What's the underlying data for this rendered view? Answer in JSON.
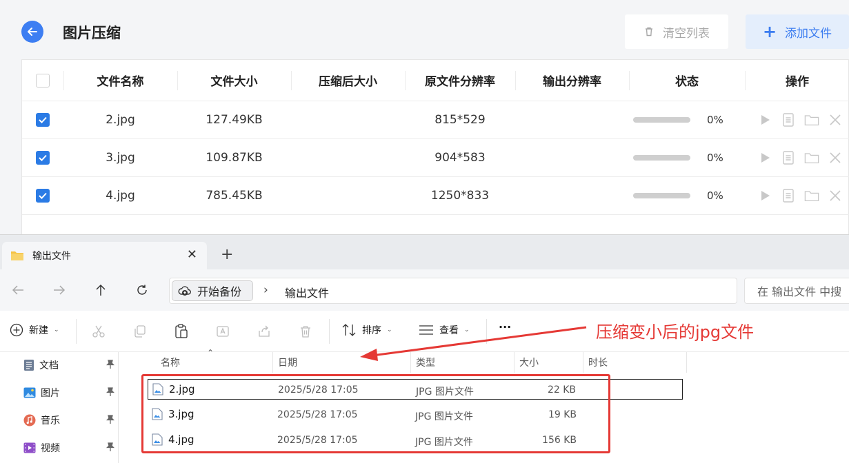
{
  "app": {
    "title": "图片压缩",
    "clear_label": "清空列表",
    "add_label": "添加文件",
    "accent_color": "#3b7cf0",
    "columns": [
      "文件名称",
      "文件大小",
      "压缩后大小",
      "原文件分辨率",
      "输出分辨率",
      "状态",
      "操作"
    ],
    "rows": [
      {
        "checked": true,
        "name": "2.jpg",
        "size": "127.49KB",
        "compressed_size": "",
        "orig_res": "815*529",
        "out_res": "",
        "progress": 0,
        "progress_text": "0%"
      },
      {
        "checked": true,
        "name": "3.jpg",
        "size": "109.87KB",
        "compressed_size": "",
        "orig_res": "904*583",
        "out_res": "",
        "progress": 0,
        "progress_text": "0%"
      },
      {
        "checked": true,
        "name": "4.jpg",
        "size": "785.45KB",
        "compressed_size": "",
        "orig_res": "1250*833",
        "out_res": "",
        "progress": 0,
        "progress_text": "0%"
      }
    ],
    "row_actions": [
      "play-icon",
      "document-icon",
      "folder-icon",
      "close-icon"
    ]
  },
  "explorer": {
    "tab_title": "输出文件",
    "breadcrumb_chip": "开始备份",
    "breadcrumb_folder": "输出文件",
    "search_placeholder": "在 输出文件 中搜",
    "toolbar": {
      "new_label": "新建",
      "sort_label": "排序",
      "view_label": "查看",
      "more_label": "···"
    },
    "sidebar": [
      {
        "label": "文档",
        "icon": "document-icon"
      },
      {
        "label": "图片",
        "icon": "picture-icon"
      },
      {
        "label": "音乐",
        "icon": "music-icon"
      },
      {
        "label": "视频",
        "icon": "video-icon"
      }
    ],
    "columns": [
      "名称",
      "日期",
      "类型",
      "大小",
      "时长"
    ],
    "files": [
      {
        "name": "2.jpg",
        "date": "2025/5/28 17:05",
        "type": "JPG 图片文件",
        "size": "22 KB",
        "selected": true
      },
      {
        "name": "3.jpg",
        "date": "2025/5/28 17:05",
        "type": "JPG 图片文件",
        "size": "19 KB",
        "selected": false
      },
      {
        "name": "4.jpg",
        "date": "2025/5/28 17:05",
        "type": "JPG 图片文件",
        "size": "156 KB",
        "selected": false
      }
    ]
  },
  "annotation": {
    "text": "压缩变小后的jpg文件",
    "color": "#e53935"
  }
}
